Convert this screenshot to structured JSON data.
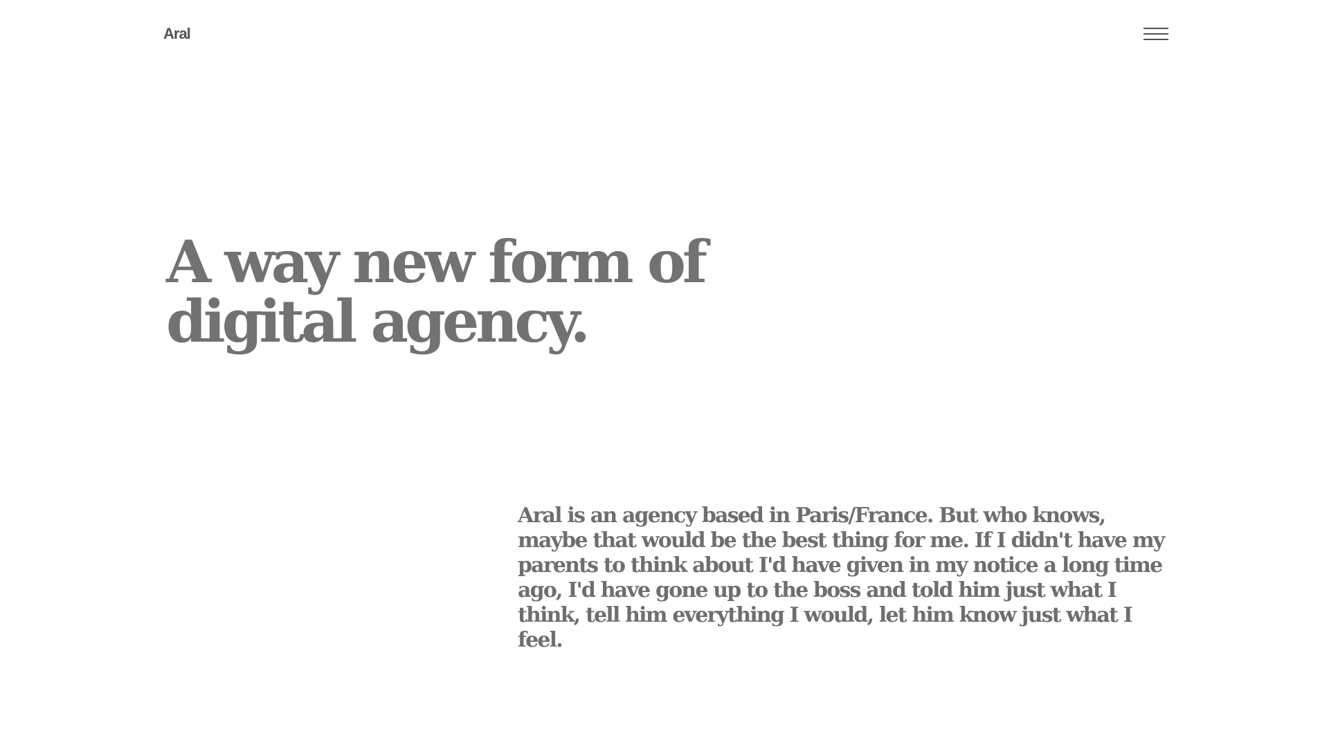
{
  "header": {
    "logo": "Aral",
    "menu_icon": "hamburger-menu-icon"
  },
  "hero": {
    "title": "A way new form of digital agency."
  },
  "intro": {
    "text": "Aral is an agency based in Paris/France. But who knows, maybe that would be the best thing for me. If I didn't have my parents to think about I'd have given in my notice a long time ago, I'd have gone up to the boss and told him just what I think, tell him everything I would, let him know just what I feel."
  },
  "colors": {
    "background": "#ffffff",
    "text": "#707070",
    "logo": "#505050"
  }
}
